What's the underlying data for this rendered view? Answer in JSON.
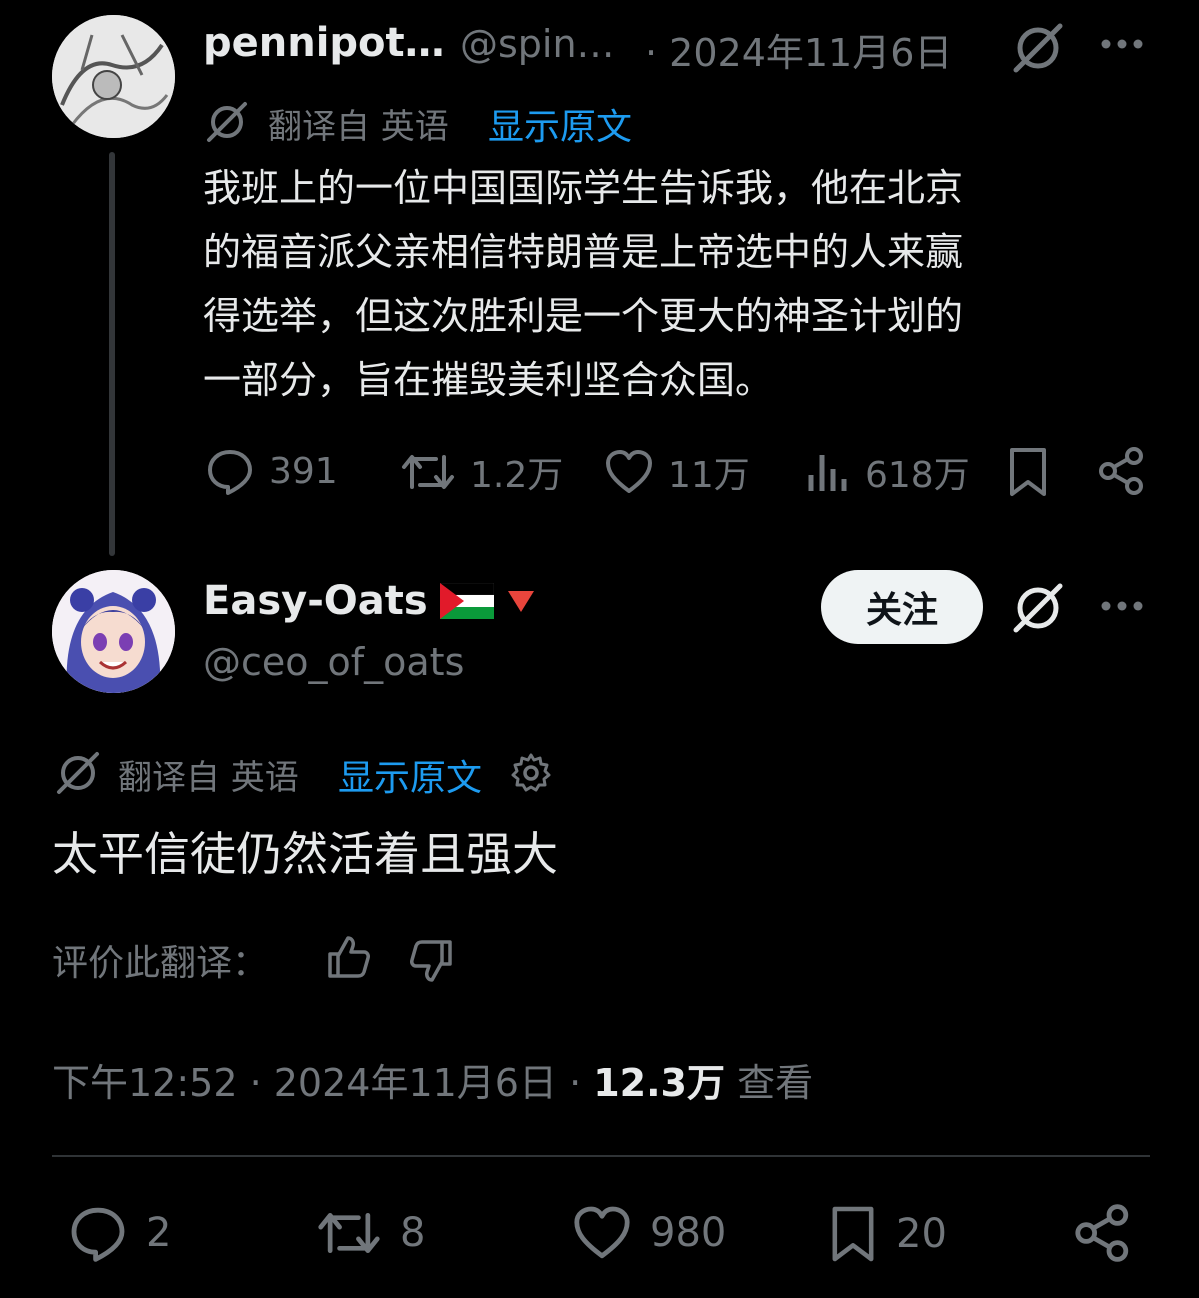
{
  "parent_tweet": {
    "display_name": "pennipot…",
    "handle": "@spin…",
    "date": "· 2024年11月6日",
    "translated_label": "翻译自 英语",
    "show_original": "显示原文",
    "text_lines": [
      "我班上的一位中国国际学生告诉我，他在北京",
      "的福音派父亲相信特朗普是上帝选中的人来赢",
      "得选举，但这次胜利是一个更大的神圣计划的",
      "一部分，旨在摧毁美利坚合众国。"
    ],
    "actions": {
      "replies": "391",
      "reposts": "1.2万",
      "likes": "11万",
      "views": "618万"
    }
  },
  "main_tweet": {
    "display_name": "Easy-Oats",
    "name_emojis": [
      "palestine-flag",
      "red-triangle"
    ],
    "handle": "@ceo_of_oats",
    "follow_label": "关注",
    "translated_label": "翻译自 英语",
    "show_original": "显示原文",
    "text": "太平信徒仍然活着且强大",
    "rate_label": "评价此翻译：",
    "time": "下午12:52 · 2024年11月6日 · ",
    "views_count": "12.3万",
    "views_label": " 查看",
    "actions": {
      "replies": "2",
      "reposts": "8",
      "likes": "980",
      "bookmarks": "20"
    }
  },
  "colors": {
    "background": "#000000",
    "text": "#e7e9ea",
    "muted": "#71767b",
    "link": "#1d9bf0"
  }
}
